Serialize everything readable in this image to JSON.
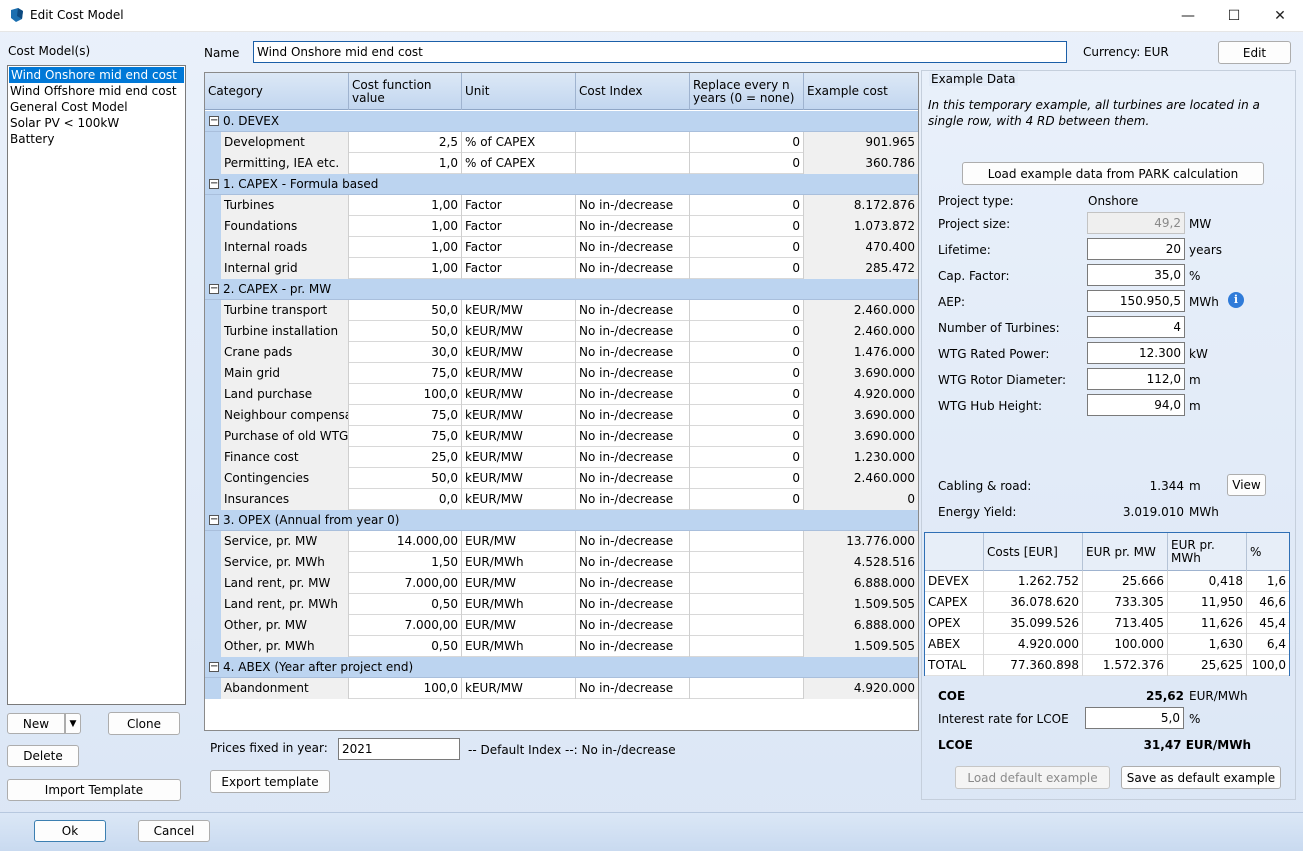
{
  "window": {
    "title": "Edit Cost Model",
    "minimize": "—",
    "maximize": "☐",
    "close": "✕"
  },
  "sidebar": {
    "label": "Cost Model(s)",
    "items": [
      "Wind Onshore mid end cost",
      "Wind Offshore mid end cost",
      "General Cost Model",
      "Solar PV < 100kW",
      "Battery"
    ],
    "selected_index": 0,
    "new_label": "New",
    "clone_label": "Clone",
    "delete_label": "Delete",
    "import_label": "Import Template"
  },
  "header": {
    "name_label": "Name",
    "name_value": "Wind Onshore mid end cost",
    "currency_label": "Currency: EUR",
    "edit_label": "Edit"
  },
  "grid": {
    "columns": [
      "Category",
      "Cost function value",
      "Unit",
      "Cost Index",
      "Replace every n years (0 = none)",
      "Example cost"
    ],
    "groups": [
      {
        "title": "0. DEVEX",
        "rows": [
          [
            "Development",
            "2,5",
            "% of CAPEX",
            "",
            "0",
            "901.965"
          ],
          [
            "Permitting, IEA etc.",
            "1,0",
            "% of CAPEX",
            "",
            "0",
            "360.786"
          ]
        ]
      },
      {
        "title": "1. CAPEX - Formula based",
        "rows": [
          [
            "Turbines",
            "1,00",
            "Factor",
            "No in-/decrease",
            "0",
            "8.172.876"
          ],
          [
            "Foundations",
            "1,00",
            "Factor",
            "No in-/decrease",
            "0",
            "1.073.872"
          ],
          [
            "Internal roads",
            "1,00",
            "Factor",
            "No in-/decrease",
            "0",
            "470.400"
          ],
          [
            "Internal grid",
            "1,00",
            "Factor",
            "No in-/decrease",
            "0",
            "285.472"
          ]
        ]
      },
      {
        "title": "2. CAPEX - pr. MW",
        "rows": [
          [
            "Turbine transport",
            "50,0",
            "kEUR/MW",
            "No in-/decrease",
            "0",
            "2.460.000"
          ],
          [
            "Turbine installation",
            "50,0",
            "kEUR/MW",
            "No in-/decrease",
            "0",
            "2.460.000"
          ],
          [
            "Crane pads",
            "30,0",
            "kEUR/MW",
            "No in-/decrease",
            "0",
            "1.476.000"
          ],
          [
            "Main grid",
            "75,0",
            "kEUR/MW",
            "No in-/decrease",
            "0",
            "3.690.000"
          ],
          [
            "Land purchase",
            "100,0",
            "kEUR/MW",
            "No in-/decrease",
            "0",
            "4.920.000"
          ],
          [
            "Neighbour compensat",
            "75,0",
            "kEUR/MW",
            "No in-/decrease",
            "0",
            "3.690.000"
          ],
          [
            "Purchase of old WTG:",
            "75,0",
            "kEUR/MW",
            "No in-/decrease",
            "0",
            "3.690.000"
          ],
          [
            "Finance cost",
            "25,0",
            "kEUR/MW",
            "No in-/decrease",
            "0",
            "1.230.000"
          ],
          [
            "Contingencies",
            "50,0",
            "kEUR/MW",
            "No in-/decrease",
            "0",
            "2.460.000"
          ],
          [
            "Insurances",
            "0,0",
            "kEUR/MW",
            "No in-/decrease",
            "0",
            "0"
          ]
        ]
      },
      {
        "title": "3. OPEX (Annual from year 0)",
        "rows": [
          [
            "Service, pr. MW",
            "14.000,00",
            "EUR/MW",
            "No in-/decrease",
            "",
            "13.776.000"
          ],
          [
            "Service, pr. MWh",
            "1,50",
            "EUR/MWh",
            "No in-/decrease",
            "",
            "4.528.516"
          ],
          [
            "Land rent, pr. MW",
            "7.000,00",
            "EUR/MW",
            "No in-/decrease",
            "",
            "6.888.000"
          ],
          [
            "Land rent, pr. MWh",
            "0,50",
            "EUR/MWh",
            "No in-/decrease",
            "",
            "1.509.505"
          ],
          [
            "Other, pr. MW",
            "7.000,00",
            "EUR/MW",
            "No in-/decrease",
            "",
            "6.888.000"
          ],
          [
            "Other, pr. MWh",
            "0,50",
            "EUR/MWh",
            "No in-/decrease",
            "",
            "1.509.505"
          ]
        ]
      },
      {
        "title": "4. ABEX (Year after project end)",
        "rows": [
          [
            "Abandonment",
            "100,0",
            "kEUR/MW",
            "No in-/decrease",
            "",
            "4.920.000"
          ]
        ]
      }
    ]
  },
  "footer_left": {
    "prices_label": "Prices fixed in year:",
    "prices_value": "2021",
    "default_index": "-- Default Index --: No in-/decrease",
    "export_label": "Export template"
  },
  "example": {
    "title": "Example Data",
    "note": "In this temporary example, all turbines are located in a single row, with 4 RD between them.",
    "load_park_label": "Load example data from PARK calculation",
    "project_type_label": "Project type:",
    "project_type_value": "Onshore",
    "fields": [
      {
        "label": "Project size:",
        "value": "49,2",
        "unit": "MW",
        "readonly": true
      },
      {
        "label": "Lifetime:",
        "value": "20",
        "unit": "years"
      },
      {
        "label": "Cap. Factor:",
        "value": "35,0",
        "unit": "%"
      },
      {
        "label": "AEP:",
        "value": "150.950,5",
        "unit": "MWh"
      },
      {
        "label": "Number of Turbines:",
        "value": "4",
        "unit": ""
      },
      {
        "label": "WTG Rated Power:",
        "value": "12.300",
        "unit": "kW"
      },
      {
        "label": "WTG Rotor Diameter:",
        "value": "112,0",
        "unit": "m"
      },
      {
        "label": "WTG Hub Height:",
        "value": "94,0",
        "unit": "m"
      }
    ],
    "cabling_label": "Cabling & road:",
    "cabling_value": "1.344",
    "cabling_unit": "m",
    "view_label": "View",
    "energy_label": "Energy Yield:",
    "energy_value": "3.019.010",
    "energy_unit": "MWh",
    "cost_table": {
      "columns": [
        "",
        "Costs [EUR]",
        "EUR pr. MW",
        "EUR pr. MWh",
        "%"
      ],
      "rows": [
        [
          "DEVEX",
          "1.262.752",
          "25.666",
          "0,418",
          "1,6"
        ],
        [
          "CAPEX",
          "36.078.620",
          "733.305",
          "11,950",
          "46,6"
        ],
        [
          "OPEX",
          "35.099.526",
          "713.405",
          "11,626",
          "45,4"
        ],
        [
          "ABEX",
          "4.920.000",
          "100.000",
          "1,630",
          "6,4"
        ],
        [
          "TOTAL",
          "77.360.898",
          "1.572.376",
          "25,625",
          "100,0"
        ]
      ]
    },
    "coe_label": "COE",
    "coe_value": "25,62",
    "coe_unit": "EUR/MWh",
    "interest_label": "Interest rate for LCOE",
    "interest_value": "5,0",
    "interest_unit": "%",
    "lcoe_label": "LCOE",
    "lcoe_value": "31,47 EUR/MWh",
    "load_default_label": "Load default example",
    "save_default_label": "Save as default example"
  },
  "bottom": {
    "ok_label": "Ok",
    "cancel_label": "Cancel"
  }
}
